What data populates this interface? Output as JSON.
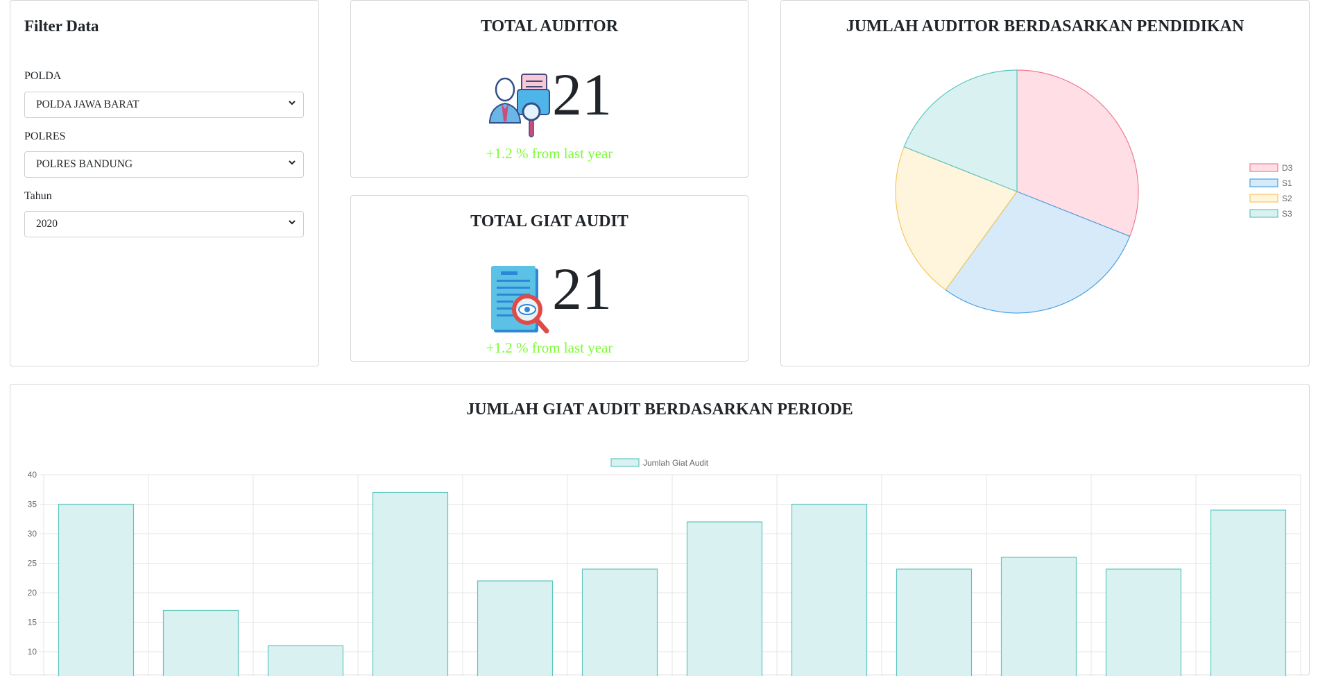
{
  "filter": {
    "title": "Filter Data",
    "polda": {
      "label": "POLDA",
      "value": "POLDA JAWA BARAT"
    },
    "polres": {
      "label": "POLRES",
      "value": "POLRES BANDUNG"
    },
    "tahun": {
      "label": "Tahun",
      "value": "2020"
    }
  },
  "total_auditor": {
    "title": "TOTAL AUDITOR",
    "value": "21",
    "change": "+1.2 % from last year",
    "icon": "auditor-icon"
  },
  "total_giat": {
    "title": "TOTAL GIAT AUDIT",
    "value": "21",
    "change": "+1.2 % from last year",
    "icon": "audit-document-icon"
  },
  "pie": {
    "title": "JUMLAH AUDITOR BERDASARKAN PENDIDIKAN"
  },
  "bar": {
    "title": "JUMLAH GIAT AUDIT BERDASARKAN PERIODE"
  },
  "colors": {
    "change_text": "#7cfc34",
    "d3_fill": "#ffdfe5",
    "d3_border": "#f27a92",
    "s1_fill": "#d7eaf9",
    "s1_border": "#4aa0e0",
    "s2_fill": "#fff4dc",
    "s2_border": "#f5c75e",
    "s3_fill": "#d9f1f0",
    "s3_border": "#5fc6c0"
  },
  "chart_data": [
    {
      "type": "pie",
      "title": "JUMLAH AUDITOR BERDASARKAN PENDIDIKAN",
      "categories": [
        "D3",
        "S1",
        "S2",
        "S3"
      ],
      "values": [
        31,
        29,
        21,
        19
      ],
      "legend": "right"
    },
    {
      "type": "bar",
      "title": "JUMLAH GIAT AUDIT BERDASARKAN PERIODE",
      "series": [
        {
          "name": "Jumlah Giat Audit",
          "values": [
            35,
            17,
            11,
            37,
            22,
            24,
            32,
            35,
            24,
            26,
            24,
            34
          ]
        }
      ],
      "yticks": [
        "40",
        "35",
        "30",
        "25",
        "20",
        "15",
        "10"
      ],
      "ylim": [
        0,
        40
      ],
      "grid": true,
      "legend": "top-center"
    }
  ]
}
